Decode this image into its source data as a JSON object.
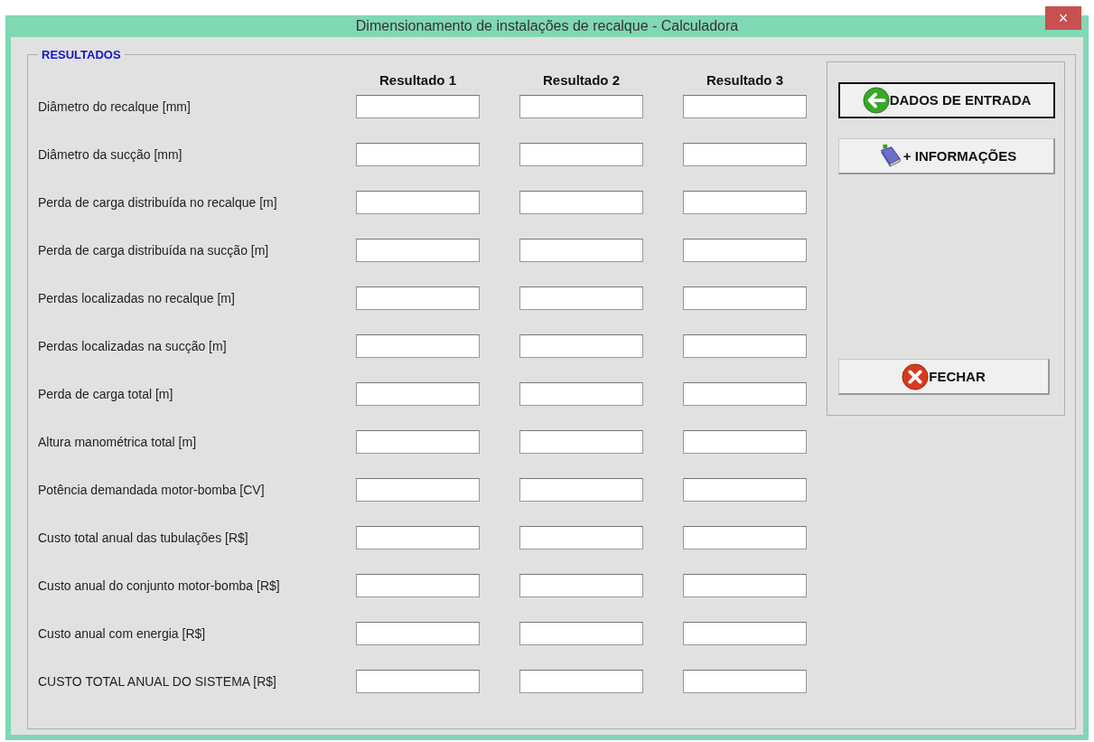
{
  "window": {
    "title": "Dimensionamento de instalações de recalque - Calculadora",
    "close": "×"
  },
  "results": {
    "legend": "RESULTADOS",
    "columns": [
      "Resultado 1",
      "Resultado 2",
      "Resultado 3"
    ],
    "rows": [
      {
        "label": "Diâmetro do recalque [mm]"
      },
      {
        "label": "Diâmetro da sucção [mm]"
      },
      {
        "label": "Perda de carga distribuída no recalque [m]"
      },
      {
        "label": "Perda de carga distribuída na sucção [m]"
      },
      {
        "label": "Perdas localizadas no recalque [m]"
      },
      {
        "label": "Perdas localizadas na sucção [m]"
      },
      {
        "label": "Perda de carga total [m]"
      },
      {
        "label": "Altura manométrica total [m]"
      },
      {
        "label": "Potência demandada motor-bomba [CV]"
      },
      {
        "label": "Custo total anual das tubulações [R$]"
      },
      {
        "label": "Custo anual do conjunto motor-bomba [R$]"
      },
      {
        "label": "Custo anual com energia [R$]"
      },
      {
        "label": "CUSTO TOTAL ANUAL DO SISTEMA [R$]"
      }
    ]
  },
  "buttons": [
    {
      "label": "DADOS DE ENTRADA",
      "kind": "back",
      "selected": true
    },
    {
      "label": "+ INFORMAÇÕES",
      "kind": "info",
      "selected": false
    },
    {
      "label": "FECHAR",
      "kind": "close",
      "selected": false
    }
  ]
}
